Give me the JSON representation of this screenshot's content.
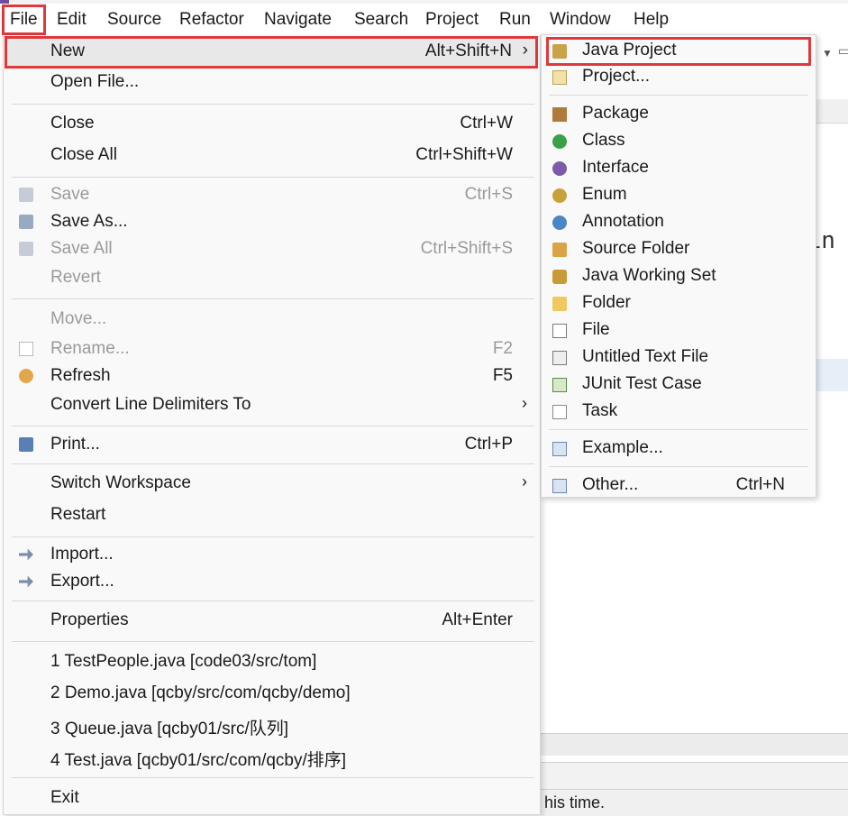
{
  "menubar": {
    "items": [
      "File",
      "Edit",
      "Source",
      "Refactor",
      "Navigate",
      "Search",
      "Project",
      "Run",
      "Window",
      "Help"
    ]
  },
  "file_menu": {
    "new": {
      "label": "New",
      "accel": "Alt+Shift+N"
    },
    "open_file": {
      "label": "Open File..."
    },
    "close": {
      "label": "Close",
      "accel": "Ctrl+W"
    },
    "close_all": {
      "label": "Close All",
      "accel": "Ctrl+Shift+W"
    },
    "save": {
      "label": "Save",
      "accel": "Ctrl+S"
    },
    "save_as": {
      "label": "Save As..."
    },
    "save_all": {
      "label": "Save All",
      "accel": "Ctrl+Shift+S"
    },
    "revert": {
      "label": "Revert"
    },
    "move": {
      "label": "Move..."
    },
    "rename": {
      "label": "Rename...",
      "accel": "F2"
    },
    "refresh": {
      "label": "Refresh",
      "accel": "F5"
    },
    "convert": {
      "label": "Convert Line Delimiters To"
    },
    "print": {
      "label": "Print...",
      "accel": "Ctrl+P"
    },
    "switch_workspace": {
      "label": "Switch Workspace"
    },
    "restart": {
      "label": "Restart"
    },
    "import": {
      "label": "Import..."
    },
    "export": {
      "label": "Export..."
    },
    "properties": {
      "label": "Properties",
      "accel": "Alt+Enter"
    },
    "recent": [
      "1 TestPeople.java  [code03/src/tom]",
      "2 Demo.java  [qcby/src/com/qcby/demo]",
      "3 Queue.java  [qcby01/src/队列]",
      "4 Test.java  [qcby01/src/com/qcby/排序]"
    ],
    "exit": {
      "label": "Exit"
    }
  },
  "new_submenu": {
    "java_project": "Java Project",
    "project": "Project...",
    "package": "Package",
    "class": "Class",
    "interface": "Interface",
    "enum": "Enum",
    "annotation": "Annotation",
    "source_folder": "Source Folder",
    "java_working_set": "Java Working Set",
    "folder": "Folder",
    "file": "File",
    "untitled_text_file": "Untitled Text File",
    "junit_test_case": "JUnit Test Case",
    "task": "Task",
    "example": "Example...",
    "other": {
      "label": "Other...",
      "accel": "Ctrl+N"
    }
  },
  "background": {
    "code_line1": "ain",
    "code_line2": "n",
    "status_text": "his time."
  },
  "arrow_glyph": "›",
  "colors": {
    "highlight": "#e0383b",
    "menu_bg": "#f9f9f9",
    "disabled": "#9a9a9a"
  }
}
